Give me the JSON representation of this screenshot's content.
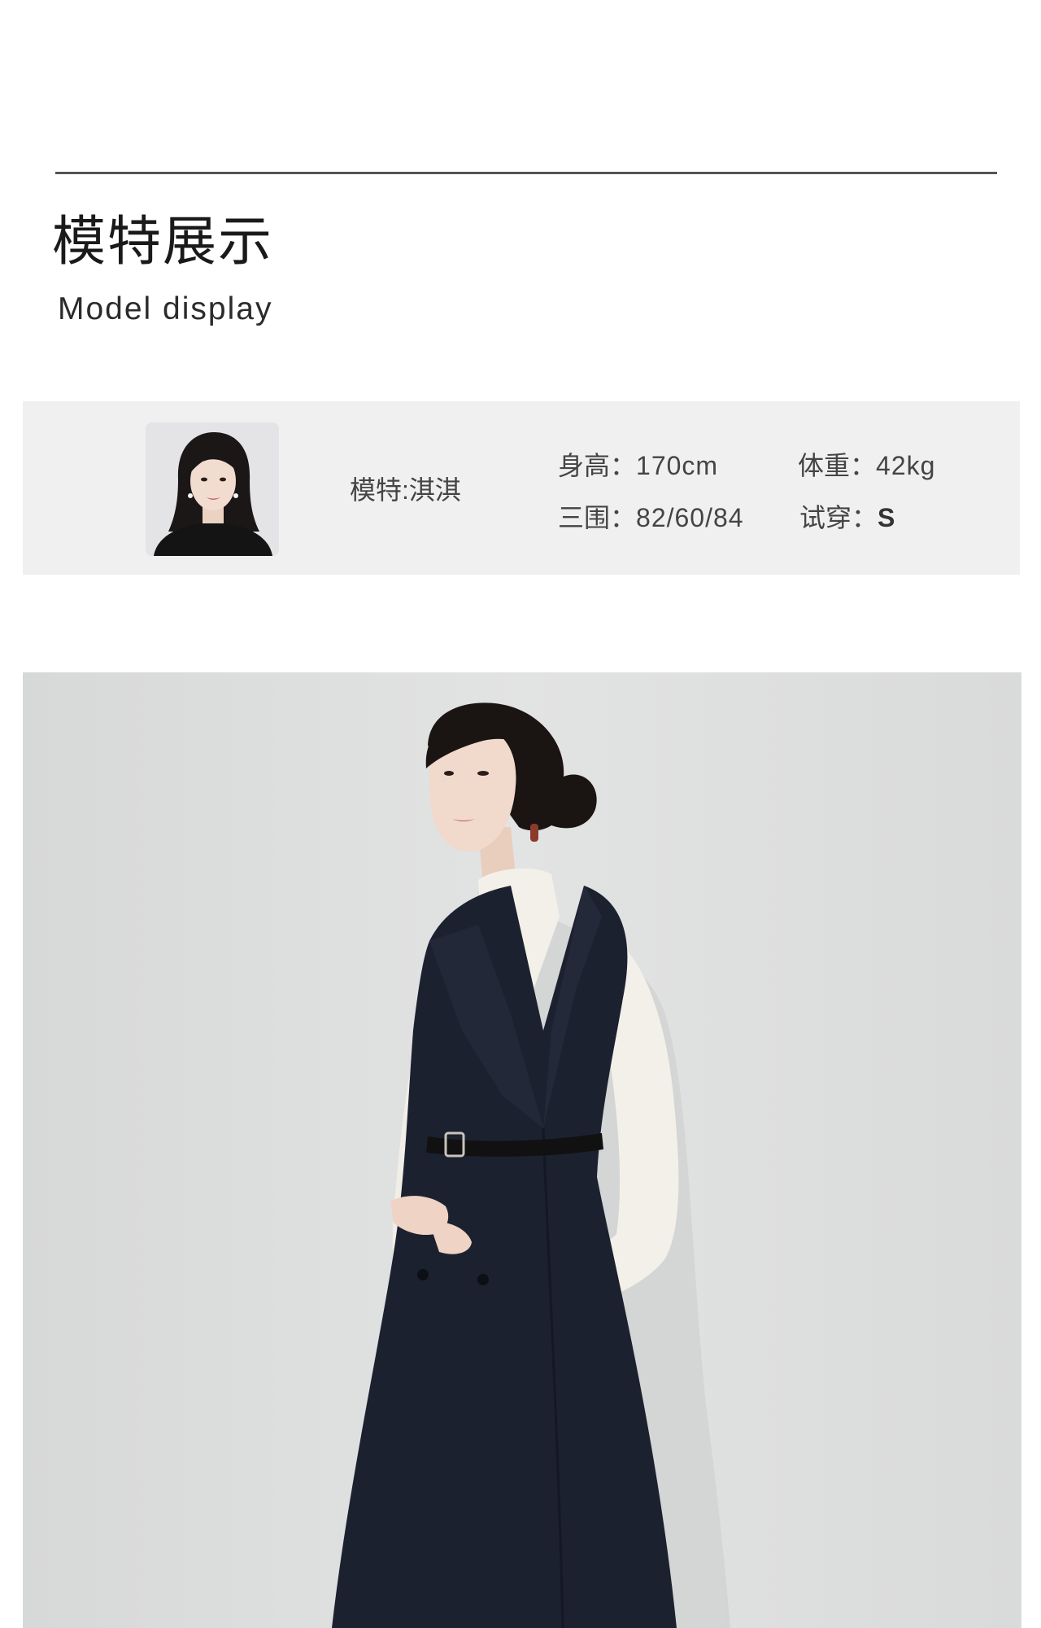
{
  "section": {
    "title": "模特展示",
    "subtitle": "Model display"
  },
  "model": {
    "avatar_icon": "model-portrait",
    "name_label": "模特:淇淇",
    "height_label": "身高：",
    "height_value": "170cm",
    "weight_label": "体重：",
    "weight_value": "42kg",
    "bust_label": "三围：",
    "bust_value": "82/60/84",
    "size_label": "试穿：",
    "size_value": "S"
  },
  "photo": {
    "icon": "model-full-body-photo"
  },
  "colors": {
    "rule": "#555555",
    "card_background": "#f0f0f0",
    "photo_background": "#dcdcdc",
    "dress": "#1c2130",
    "sweater": "#f4f1ea"
  }
}
